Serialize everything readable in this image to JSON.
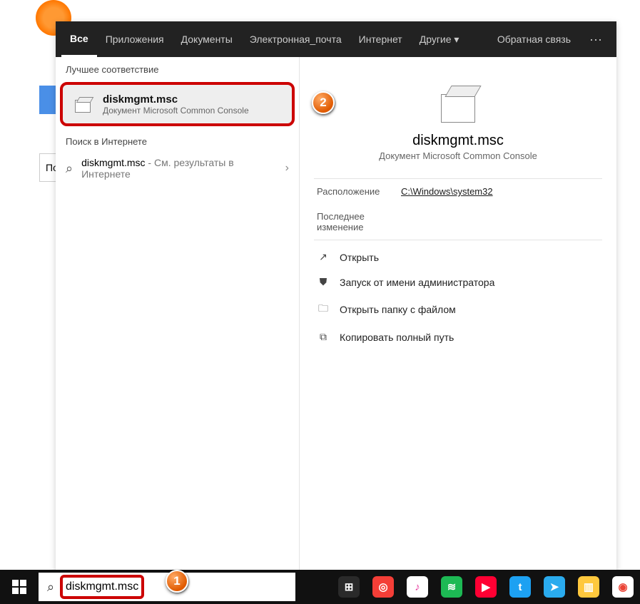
{
  "bg": {
    "partial_text": "По"
  },
  "tabs": {
    "items": [
      "Все",
      "Приложения",
      "Документы",
      "Электронная_почта",
      "Интернет",
      "Другие ▾"
    ],
    "feedback": "Обратная связь",
    "more": "···"
  },
  "left": {
    "best_header": "Лучшее соответствие",
    "best_title": "diskmgmt.msc",
    "best_sub": "Документ Microsoft Common Console",
    "web_header": "Поиск в Интернете",
    "web_query": "diskmgmt.msc",
    "web_hint": " - См. результаты в Интернете",
    "chevron": "›"
  },
  "detail": {
    "title": "diskmgmt.msc",
    "sub": "Документ Microsoft Common Console",
    "location_label": "Расположение",
    "location_value": "C:\\Windows\\system32",
    "modified_label": "Последнее изменение",
    "actions": [
      {
        "icon": "↗",
        "label": "Открыть"
      },
      {
        "icon": "⛊",
        "label": "Запуск от имени администратора"
      },
      {
        "icon": "🗀",
        "label": "Открыть папку с файлом"
      },
      {
        "icon": "⧉",
        "label": "Копировать полный путь"
      }
    ]
  },
  "taskbar": {
    "search_glyph": "⌕",
    "search_value": "diskmgmt.msc",
    "apps": [
      {
        "name": "calculator",
        "bg": "#2a2a2a",
        "glyph": "⊞"
      },
      {
        "name": "pocketcasts",
        "bg": "#f43e37",
        "glyph": "◎"
      },
      {
        "name": "itunes",
        "bg": "#ffffff",
        "glyph": "♪",
        "fg": "#e73ea0"
      },
      {
        "name": "spotify",
        "bg": "#1DB954",
        "glyph": "≋"
      },
      {
        "name": "youtube-music",
        "bg": "#ff0033",
        "glyph": "▶"
      },
      {
        "name": "twitter",
        "bg": "#1DA1F2",
        "glyph": "t"
      },
      {
        "name": "telegram",
        "bg": "#2AABEE",
        "glyph": "➤"
      },
      {
        "name": "files",
        "bg": "#FFC83D",
        "glyph": "▥"
      },
      {
        "name": "chrome",
        "bg": "#ffffff",
        "glyph": "◉",
        "fg": "#ea4335"
      }
    ]
  },
  "callouts": {
    "one": "1",
    "two": "2"
  }
}
